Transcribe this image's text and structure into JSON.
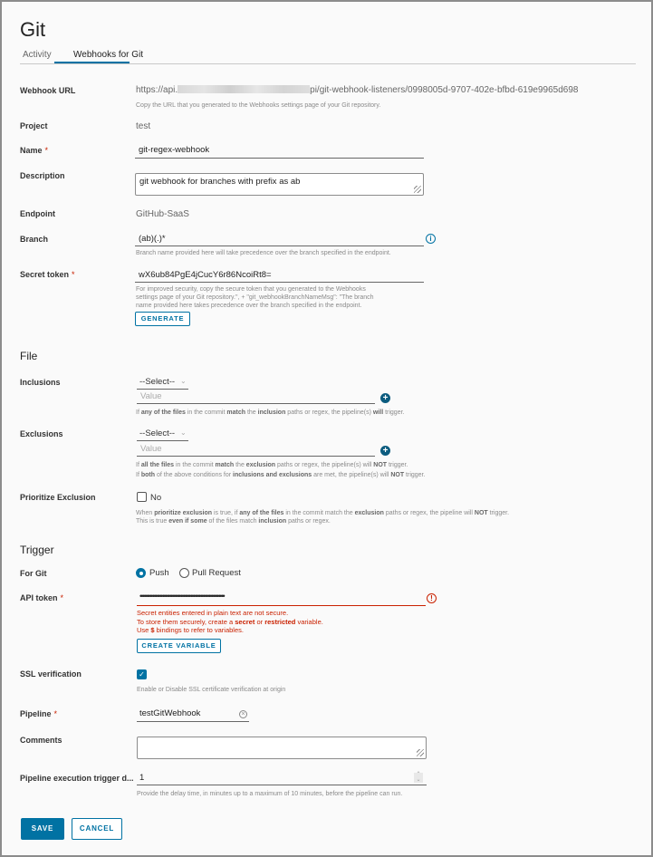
{
  "page": {
    "title": "Git"
  },
  "tabs": [
    {
      "label": "Activity",
      "active": false
    },
    {
      "label": "Webhooks for Git",
      "active": true
    }
  ],
  "form": {
    "webhook_url": {
      "label": "Webhook URL",
      "value_prefix": "https://api.",
      "value_suffix": "pi/git-webhook-listeners/0998005d-9707-402e-bfbd-619e9965d698",
      "help": "Copy the URL that you generated to the Webhooks settings page of your Git repository."
    },
    "project": {
      "label": "Project",
      "value": "test"
    },
    "name": {
      "label": "Name",
      "required": "*",
      "value": "git-regex-webhook"
    },
    "description": {
      "label": "Description",
      "value": "git webhook for branches with prefix as ab"
    },
    "endpoint": {
      "label": "Endpoint",
      "value": "GitHub-SaaS"
    },
    "branch": {
      "label": "Branch",
      "value": "(ab)(.)*",
      "help": "Branch name provided here will take precedence over the branch specified in the endpoint.",
      "info_icon": "info-icon"
    },
    "secret_token": {
      "label": "Secret token",
      "required": "*",
      "value": "wX6ub84PgE4jCucY6r86NcoiRt8=",
      "help_line1": "For improved security, copy the secure token that you generated to the Webhooks",
      "help_line2": "settings page of your Git repository.\", + \"git_webhookBranchNameMsg\": \"The branch",
      "help_line3": "name provided here takes precedence over the branch specified in the endpoint.",
      "generate_label": "GENERATE"
    }
  },
  "file_section": {
    "title": "File",
    "inclusions": {
      "label": "Inclusions",
      "select_value": "--Select--",
      "value_placeholder": "Value",
      "help_parts": [
        "If ",
        "any of the files",
        " in the commit ",
        "match",
        " the ",
        "inclusion",
        " paths or regex, the pipeline(s) ",
        "will",
        " trigger."
      ]
    },
    "exclusions": {
      "label": "Exclusions",
      "select_value": "--Select--",
      "value_placeholder": "Value",
      "help1_parts": [
        "If ",
        "all the files",
        " in the commit ",
        "match",
        " the ",
        "exclusion",
        " paths or regex, the pipeline(s) will ",
        "NOT",
        " trigger."
      ],
      "help2_parts": [
        "If ",
        "both",
        " of the above conditions for ",
        "inclusions and exclusions",
        " are met, the pipeline(s) will ",
        "NOT",
        " trigger."
      ]
    },
    "prioritize_exclusion": {
      "label": "Prioritize Exclusion",
      "checkbox_label": "No",
      "checked": false,
      "help1_parts": [
        "When ",
        "prioritize exclusion",
        " is true, if ",
        "any of the files",
        " in the commit match the ",
        "exclusion",
        " paths or regex, the pipeline will ",
        "NOT",
        " trigger."
      ],
      "help2_parts": [
        "This is true ",
        "even if some",
        " of the files match ",
        "inclusion",
        " paths or regex."
      ]
    }
  },
  "trigger_section": {
    "title": "Trigger",
    "for_git": {
      "label": "For Git",
      "options": [
        {
          "label": "Push",
          "selected": true
        },
        {
          "label": "Pull Request",
          "selected": false
        }
      ]
    },
    "api_token": {
      "label": "API token",
      "required": "*",
      "masked_value": "••••••••••••••••••••••••••••••••••••••••••••••••••••••••••••",
      "error_line1": "Secret entities entered in plain text are not secure.",
      "error_line2_parts": [
        "To store them securely, create a ",
        "secret",
        " or ",
        "restricted",
        " variable."
      ],
      "error_line3_parts": [
        "Use ",
        "$",
        " bindings to refer to variables."
      ],
      "create_variable_label": "CREATE VARIABLE"
    },
    "ssl_verification": {
      "label": "SSL verification",
      "checked": true,
      "help": "Enable or Disable SSL certificate verification at origin"
    },
    "pipeline": {
      "label": "Pipeline",
      "required": "*",
      "value": "testGitWebhook"
    },
    "comments": {
      "label": "Comments",
      "value": ""
    },
    "delay": {
      "label": "Pipeline execution trigger d...",
      "value": "1",
      "help": "Provide the delay time, in minutes up to a maximum of 10 minutes, before the pipeline can run."
    }
  },
  "actions": {
    "save_label": "SAVE",
    "cancel_label": "CANCEL"
  },
  "colors": {
    "accent": "#0072a3",
    "error": "#c92100",
    "background": "#fafafa"
  }
}
